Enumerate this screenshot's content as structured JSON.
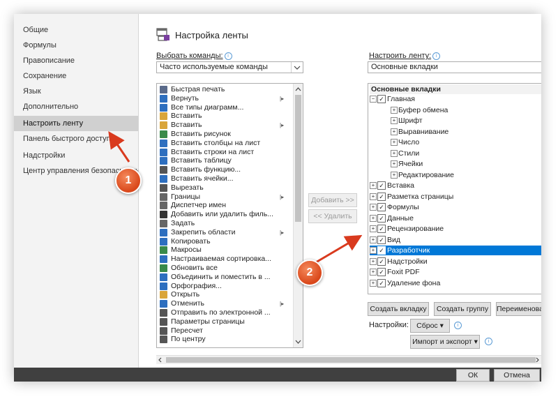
{
  "sidebar": {
    "items": [
      {
        "label": "Общие"
      },
      {
        "label": "Формулы"
      },
      {
        "label": "Правописание"
      },
      {
        "label": "Сохранение"
      },
      {
        "label": "Язык"
      },
      {
        "label": "Дополнительно"
      },
      {
        "label": "Настроить ленту",
        "active": true
      },
      {
        "label": "Панель быстрого доступа"
      },
      {
        "label": "Надстройки"
      },
      {
        "label": "Центр управления безопасностью"
      }
    ]
  },
  "header": {
    "title": "Настройка ленты",
    "icon": "ribbon-customize-icon"
  },
  "left": {
    "label": "Выбрать команды:",
    "combo_value": "Часто используемые команды",
    "commands": [
      {
        "label": "Быстрая печать",
        "icon": "quick-print-icon",
        "color": "#5a6a8a"
      },
      {
        "label": "Вернуть",
        "icon": "redo-icon",
        "color": "#2e6fbf",
        "submenu": true
      },
      {
        "label": "Все типы диаграмм...",
        "icon": "chart-icon",
        "color": "#2e6fbf"
      },
      {
        "label": "Вставить",
        "icon": "paste-icon",
        "color": "#d9a53a"
      },
      {
        "label": "Вставить",
        "icon": "paste-icon",
        "color": "#d9a53a",
        "submenu": true
      },
      {
        "label": "Вставить рисунок",
        "icon": "picture-icon",
        "color": "#3a8a4a"
      },
      {
        "label": "Вставить столбцы на лист",
        "icon": "insert-columns-icon",
        "color": "#2e6fbf"
      },
      {
        "label": "Вставить строки на лист",
        "icon": "insert-rows-icon",
        "color": "#2e6fbf"
      },
      {
        "label": "Вставить таблицу",
        "icon": "table-icon",
        "color": "#2e6fbf"
      },
      {
        "label": "Вставить функцию...",
        "icon": "function-icon",
        "color": "#555555"
      },
      {
        "label": "Вставить ячейки...",
        "icon": "insert-cells-icon",
        "color": "#2e6fbf"
      },
      {
        "label": "Вырезать",
        "icon": "cut-icon",
        "color": "#555555"
      },
      {
        "label": "Границы",
        "icon": "borders-icon",
        "color": "#666666",
        "submenu": true
      },
      {
        "label": "Диспетчер имен",
        "icon": "name-manager-icon",
        "color": "#666666"
      },
      {
        "label": "Добавить или удалить филь...",
        "icon": "filter-icon",
        "color": "#333333"
      },
      {
        "label": "Задать",
        "icon": "set-area-icon",
        "color": "#666666"
      },
      {
        "label": "Закрепить области",
        "icon": "freeze-panes-icon",
        "color": "#2e6fbf",
        "submenu": true
      },
      {
        "label": "Копировать",
        "icon": "copy-icon",
        "color": "#2e6fbf"
      },
      {
        "label": "Макросы",
        "icon": "macros-icon",
        "color": "#3a8a4a"
      },
      {
        "label": "Настраиваемая сортировка...",
        "icon": "sort-icon",
        "color": "#2e6fbf"
      },
      {
        "label": "Обновить все",
        "icon": "refresh-icon",
        "color": "#3a8a4a"
      },
      {
        "label": "Объединить и поместить в ...",
        "icon": "merge-icon",
        "color": "#2e6fbf"
      },
      {
        "label": "Орфография...",
        "icon": "spelling-icon",
        "color": "#2e6fbf"
      },
      {
        "label": "Открыть",
        "icon": "open-icon",
        "color": "#d9a53a"
      },
      {
        "label": "Отменить",
        "icon": "undo-icon",
        "color": "#2e6fbf",
        "submenu": true
      },
      {
        "label": "Отправить по электронной ...",
        "icon": "email-icon",
        "color": "#555555"
      },
      {
        "label": "Параметры страницы",
        "icon": "page-setup-icon",
        "color": "#555555"
      },
      {
        "label": "Пересчет",
        "icon": "calculate-icon",
        "color": "#555555"
      },
      {
        "label": "По центру",
        "icon": "align-center-icon",
        "color": "#555555"
      }
    ]
  },
  "middle": {
    "add_label": "Добавить >>",
    "remove_label": "<< Удалить"
  },
  "right": {
    "label": "Настроить ленту:",
    "combo_value": "Основные вкладки",
    "tree_header": "Основные вкладки",
    "tree": [
      {
        "label": "Главная",
        "level": 0,
        "exp": "−",
        "checked": true
      },
      {
        "label": "Буфер обмена",
        "level": 1,
        "exp": "+"
      },
      {
        "label": "Шрифт",
        "level": 1,
        "exp": "+"
      },
      {
        "label": "Выравнивание",
        "level": 1,
        "exp": "+"
      },
      {
        "label": "Число",
        "level": 1,
        "exp": "+"
      },
      {
        "label": "Стили",
        "level": 1,
        "exp": "+"
      },
      {
        "label": "Ячейки",
        "level": 1,
        "exp": "+"
      },
      {
        "label": "Редактирование",
        "level": 1,
        "exp": "+"
      },
      {
        "label": "Вставка",
        "level": 0,
        "exp": "+",
        "checked": true
      },
      {
        "label": "Разметка страницы",
        "level": 0,
        "exp": "+",
        "checked": true
      },
      {
        "label": "Формулы",
        "level": 0,
        "exp": "+",
        "checked": true
      },
      {
        "label": "Данные",
        "level": 0,
        "exp": "+",
        "checked": true
      },
      {
        "label": "Рецензирование",
        "level": 0,
        "exp": "+",
        "checked": true
      },
      {
        "label": "Вид",
        "level": 0,
        "exp": "+",
        "checked": true
      },
      {
        "label": "Разработчик",
        "level": 0,
        "exp": "+",
        "checked": true,
        "selected": true
      },
      {
        "label": "Надстройки",
        "level": 0,
        "exp": "+",
        "checked": true
      },
      {
        "label": "Foxit PDF",
        "level": 0,
        "exp": "+",
        "checked": true
      },
      {
        "label": "Удаление фона",
        "level": 0,
        "exp": "+",
        "checked": true
      }
    ],
    "new_tab_label": "Создать вкладку",
    "new_group_label": "Создать группу",
    "rename_label": "Переименовани",
    "settings_label": "Настройки:",
    "reset_label": "Сброс ▾",
    "import_export_label": "Импорт и экспорт ▾"
  },
  "footer": {
    "ok_label": "ОК",
    "cancel_label": "Отмена"
  },
  "badges": {
    "one": "1",
    "two": "2"
  },
  "colors": {
    "accent": "#0078d7",
    "badge": "#e2572a",
    "arrow": "#d93a1e"
  }
}
